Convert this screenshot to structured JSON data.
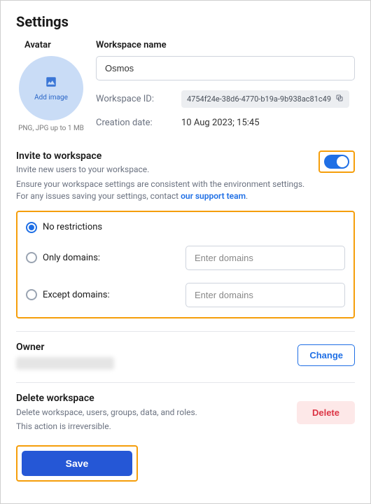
{
  "title": "Settings",
  "avatar": {
    "label": "Avatar",
    "add_text": "Add image",
    "hint": "PNG, JPG up to 1 MB"
  },
  "workspace": {
    "name_label": "Workspace name",
    "name_value": "Osmos",
    "id_label": "Workspace ID:",
    "id_value": "4754f24e-38d6-4770-b19a-9b938ac81c49",
    "created_label": "Creation date:",
    "created_value": "10 Aug 2023; 15:45"
  },
  "invite": {
    "title": "Invite to workspace",
    "subtitle": "Invite new users to your workspace.",
    "note_prefix": "Ensure your workspace settings are consistent with the environment settings. For any issues saving your settings, contact ",
    "note_link": "our support team",
    "note_suffix": ".",
    "toggle_on": true,
    "options": {
      "none": "No restrictions",
      "only": "Only domains:",
      "except": "Except domains:",
      "placeholder": "Enter domains",
      "selected": "none"
    }
  },
  "owner": {
    "label": "Owner",
    "change": "Change"
  },
  "delete": {
    "title": "Delete workspace",
    "desc1": "Delete workspace, users, groups, data, and roles.",
    "desc2": "This action is irreversible.",
    "button": "Delete"
  },
  "actions": {
    "save": "Save"
  }
}
